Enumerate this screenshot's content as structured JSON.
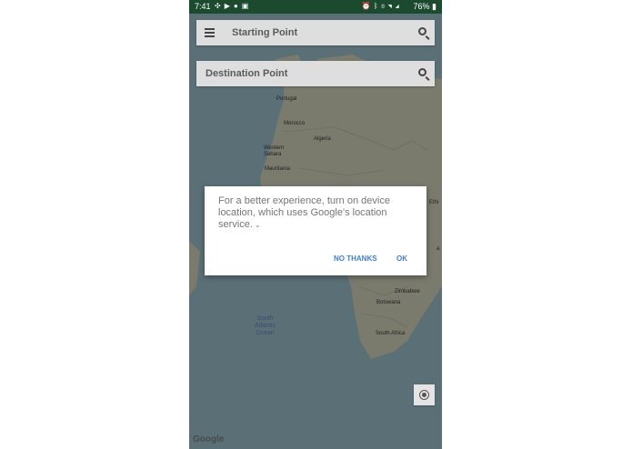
{
  "status_bar": {
    "time": "7:41",
    "battery": "76%",
    "left_icons": [
      "slack-icon",
      "youtube-icon",
      "messenger-icon",
      "image-icon"
    ],
    "right_icons": [
      "alarm-icon",
      "bluetooth-icon",
      "vibrate-icon",
      "wifi-icon",
      "signal-icon",
      "battery-icon"
    ]
  },
  "search": {
    "start_label": "Starting Point",
    "destination_label": "Destination Point"
  },
  "dialog": {
    "message": "For a better experience, turn on device location, which uses Google's location service.",
    "no_thanks": "NO THANKS",
    "ok": "OK"
  },
  "map": {
    "labels": {
      "portugal": "Portugal",
      "morocco": "Morocco",
      "algeria": "Algeria",
      "western_sahara": "Western\nSahara",
      "mauritania": "Mauritania",
      "ethiopia": "Ethi",
      "zimbabwe": "Zimbabwe",
      "botswana": "Botswana",
      "south_africa": "South Africa",
      "south_atlantic": "South\nAtlantic\nOcean",
      "east_edge": "a"
    },
    "attribution": "Google"
  },
  "colors": {
    "status_bar": "#1b4a2f",
    "accent": "#3f7fcf",
    "ocean": "#7e9aa5",
    "land": "#a9aa98"
  }
}
